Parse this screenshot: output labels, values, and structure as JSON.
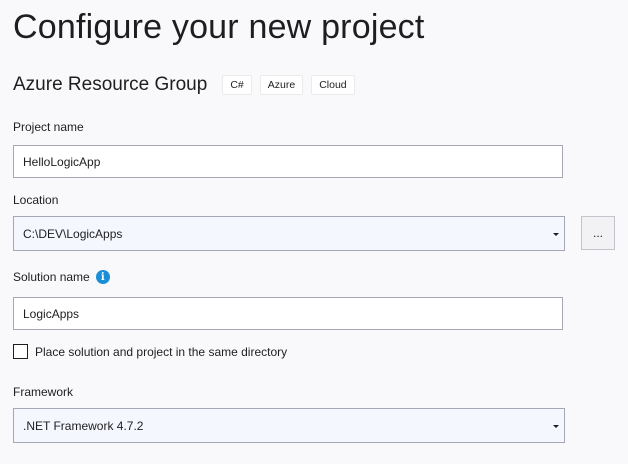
{
  "page": {
    "title": "Configure your new project"
  },
  "template": {
    "name": "Azure Resource Group",
    "tags": [
      "C#",
      "Azure",
      "Cloud"
    ]
  },
  "project_name": {
    "label": "Project name",
    "value": "HelloLogicApp"
  },
  "location": {
    "label": "Location",
    "value": "C:\\DEV\\LogicApps",
    "browse_label": "..."
  },
  "solution_name": {
    "label": "Solution name",
    "info_icon": "i",
    "value": "LogicApps"
  },
  "same_directory": {
    "label": "Place solution and project in the same directory",
    "checked": false
  },
  "framework": {
    "label": "Framework",
    "value": ".NET Framework 4.7.2"
  },
  "icons": {
    "info": "info-icon",
    "dropdown": "chevron-down-icon"
  },
  "colors": {
    "info_icon": "#1b8fd6",
    "select_background": "#f5f7ff",
    "page_background": "#f9f9fb"
  }
}
